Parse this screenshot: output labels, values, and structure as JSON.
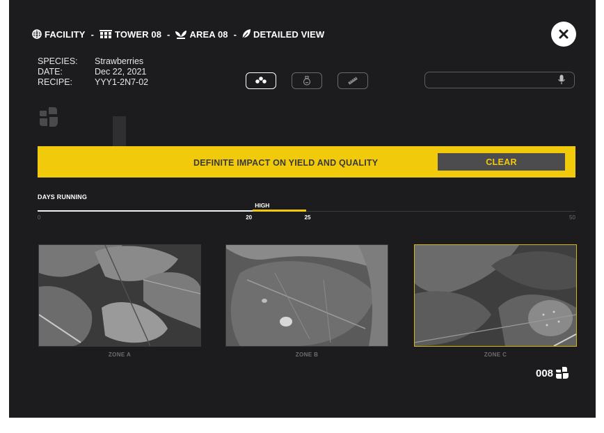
{
  "breadcrumb": {
    "facility": "FACILITY",
    "tower": "TOWER 08",
    "area": "AREA 08",
    "view": "DETAILED VIEW",
    "separator": "-"
  },
  "meta": {
    "species_label": "SPECIES:",
    "species_value": "Strawberries",
    "date_label": "DATE:",
    "date_value": "Dec 22, 2021",
    "recipe_label": "RECIPE:",
    "recipe_value": "YYY1-2N7-02"
  },
  "toolbar": {
    "icons": [
      "scatter-icon",
      "flask-icon",
      "ruler-icon"
    ],
    "active": "scatter-icon"
  },
  "search": {
    "placeholder": "",
    "value": ""
  },
  "alert": {
    "message": "DEFINITE IMPACT ON YIELD AND QUALITY",
    "clear_label": "CLEAR",
    "color": "#f1ca0c"
  },
  "progress": {
    "label": "DAYS RUNNING",
    "min_label": "0",
    "max_label": "50",
    "current_label": "20",
    "high_end_label": "25",
    "high_label": "HIGH",
    "min": 0,
    "max": 50,
    "current": 20,
    "high_start": 20,
    "high_end": 25
  },
  "zones": [
    {
      "caption": "ZONE A",
      "selected": false
    },
    {
      "caption": "ZONE B",
      "selected": false
    },
    {
      "caption": "ZONE C",
      "selected": true
    }
  ],
  "counter": {
    "value": "008"
  },
  "colors": {
    "background": "#1c1c1e",
    "accent": "#f1ca0c",
    "button_dark": "#4c4c4e"
  }
}
